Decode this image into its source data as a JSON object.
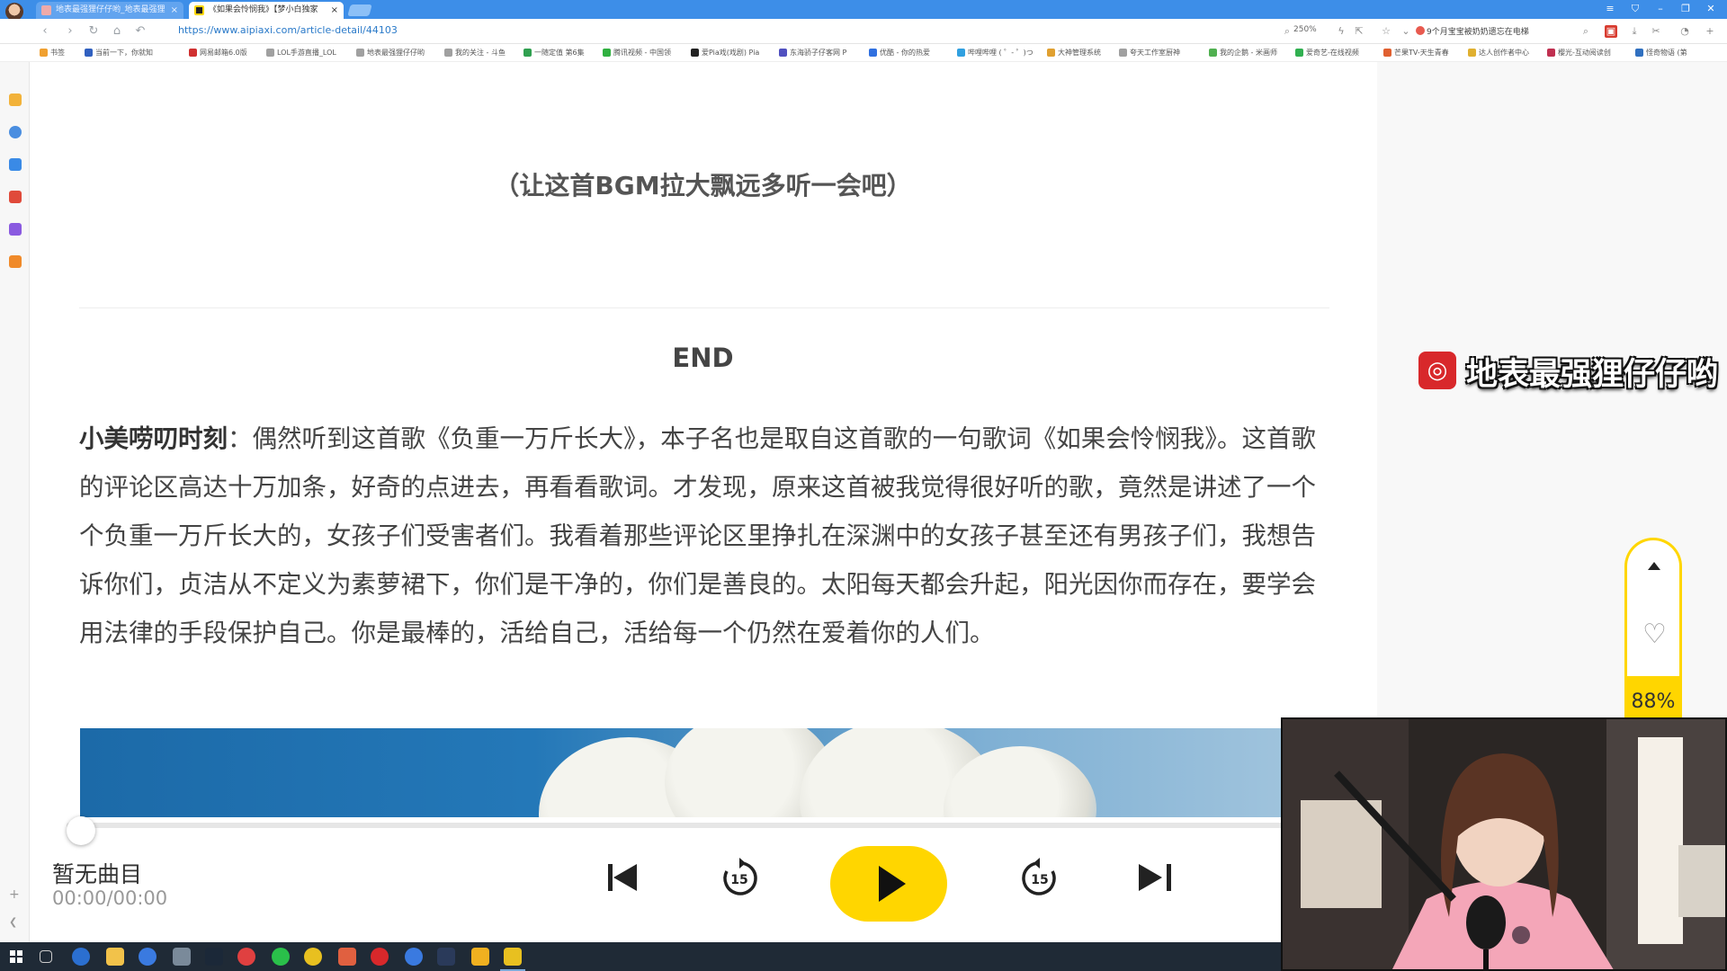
{
  "browser": {
    "tabs": [
      {
        "title": "地表最强狸仔仔哟_地表最强狸",
        "active": false
      },
      {
        "title": "《如果会怜悯我》【梦小白独家",
        "active": true
      }
    ],
    "url": "https://www.aipiaxi.com/article-detail/44103",
    "zoom": "250%",
    "news_text": "9个月宝宝被奶奶遗忘在电梯",
    "bookmarks": [
      "书签",
      "当前一下，你就知",
      "网易邮箱6.0版",
      "LOL手游直播_LOL",
      "地表最强狸仔仔哟",
      "我的关注 - 斗鱼",
      "一随定值 第6集",
      "腾讯视频 - 中国领",
      "爱Pia戏(戏剧) Pia",
      "东海骄子仔客网 P",
      "优酷 - 你的热爱",
      "哔哩哔哩 ( ゜- ゜)つ",
      "大神管理系统",
      "夸天工作室厨神",
      "我的企鹅 - 米画师",
      "爱奇艺-在线视频",
      "芒果TV-天生青春",
      "达人创作者中心",
      "樱光-互动阅读创",
      "怪奇物语 (第"
    ]
  },
  "article": {
    "bgm_note": "（让这首BGM拉大飘远多听一会吧）",
    "end_title": "END",
    "lead": "小美唠叨时刻",
    "body": "：偶然听到这首歌《负重一万斤长大》，本子名也是取自这首歌的一句歌词《如果会怜悯我》。这首歌的评论区高达十万加条，好奇的点进去，再看看歌词。才发现，原来这首被我觉得很好听的歌，竟然是讲述了一个个负重一万斤长大的，女孩子们受害者们。我看着那些评论区里挣扎在深渊中的女孩子甚至还有男孩子们，我想告诉你们，贞洁从不定义为素萝裙下，你们是干净的，你们是善良的。太阳每天都会升起，阳光因你而存在，要学会用法律的手段保护自己。你是最棒的，活给自己，活给每一个仍然在爱着你的人们。"
  },
  "watermark": {
    "text": "地表最强狸仔仔哟"
  },
  "side_widget": {
    "progress_label": "88%",
    "progress": 0.88
  },
  "player": {
    "track_name": "暂无曲目",
    "time": "00:00/00:00",
    "skip_back_label": "15",
    "skip_forward_label": "15",
    "progress": 0
  },
  "colors": {
    "accent": "#ffd600",
    "browser_chrome": "#3d8ee8",
    "link": "#2a7ac9",
    "netease_red": "#d8282b"
  }
}
